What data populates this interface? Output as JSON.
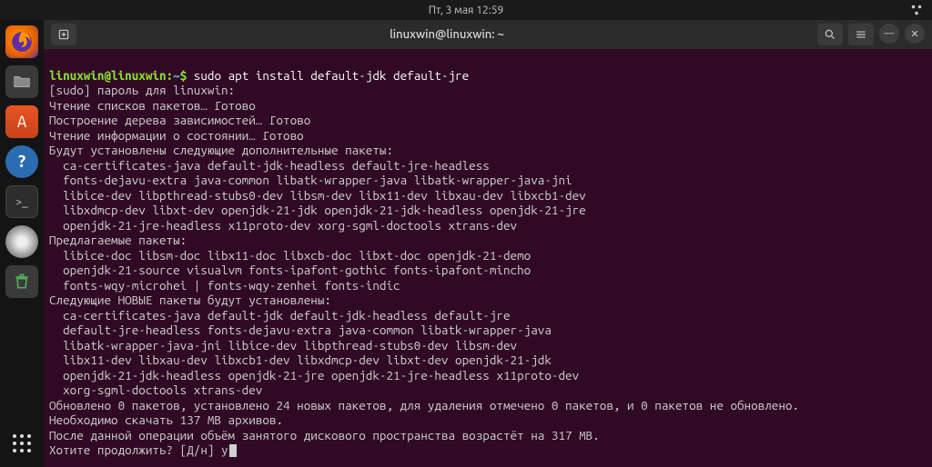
{
  "topbar": {
    "datetime": "Пт, 3 мая  12:59"
  },
  "dock": {
    "items": [
      "firefox",
      "files",
      "software",
      "help",
      "terminal",
      "disc",
      "trash"
    ]
  },
  "window": {
    "title": "linuxwin@linuxwin: ~"
  },
  "terminal": {
    "prompt_user": "linuxwin@linuxwin",
    "prompt_sep": ":",
    "prompt_path": "~",
    "prompt_dollar": "$ ",
    "command": "sudo apt install default-jdk default-jre",
    "lines": [
      "[sudo] пароль для linuxwin:",
      "Чтение списков пакетов… Готово",
      "Построение дерева зависимостей… Готово",
      "Чтение информации о состоянии… Готово",
      "Будут установлены следующие дополнительные пакеты:",
      "  ca-certificates-java default-jdk-headless default-jre-headless",
      "  fonts-dejavu-extra java-common libatk-wrapper-java libatk-wrapper-java-jni",
      "  libice-dev libpthread-stubs0-dev libsm-dev libx11-dev libxau-dev libxcb1-dev",
      "  libxdmcp-dev libxt-dev openjdk-21-jdk openjdk-21-jdk-headless openjdk-21-jre",
      "  openjdk-21-jre-headless x11proto-dev xorg-sgml-doctools xtrans-dev",
      "Предлагаемые пакеты:",
      "  libice-doc libsm-doc libx11-doc libxcb-doc libxt-doc openjdk-21-demo",
      "  openjdk-21-source visualvm fonts-ipafont-gothic fonts-ipafont-mincho",
      "  fonts-wqy-microhei | fonts-wqy-zenhei fonts-indic",
      "Следующие НОВЫЕ пакеты будут установлены:",
      "  ca-certificates-java default-jdk default-jdk-headless default-jre",
      "  default-jre-headless fonts-dejavu-extra java-common libatk-wrapper-java",
      "  libatk-wrapper-java-jni libice-dev libpthread-stubs0-dev libsm-dev",
      "  libx11-dev libxau-dev libxcb1-dev libxdmcp-dev libxt-dev openjdk-21-jdk",
      "  openjdk-21-jdk-headless openjdk-21-jre openjdk-21-jre-headless x11proto-dev",
      "  xorg-sgml-doctools xtrans-dev",
      "Обновлено 0 пакетов, установлено 24 новых пакетов, для удаления отмечено 0 пакетов, и 0 пакетов не обновлено.",
      "Необходимо скачать 137 MB архивов.",
      "После данной операции объём занятого дискового пространства возрастёт на 317 MB.",
      "Хотите продолжить? [Д/н] y"
    ]
  }
}
